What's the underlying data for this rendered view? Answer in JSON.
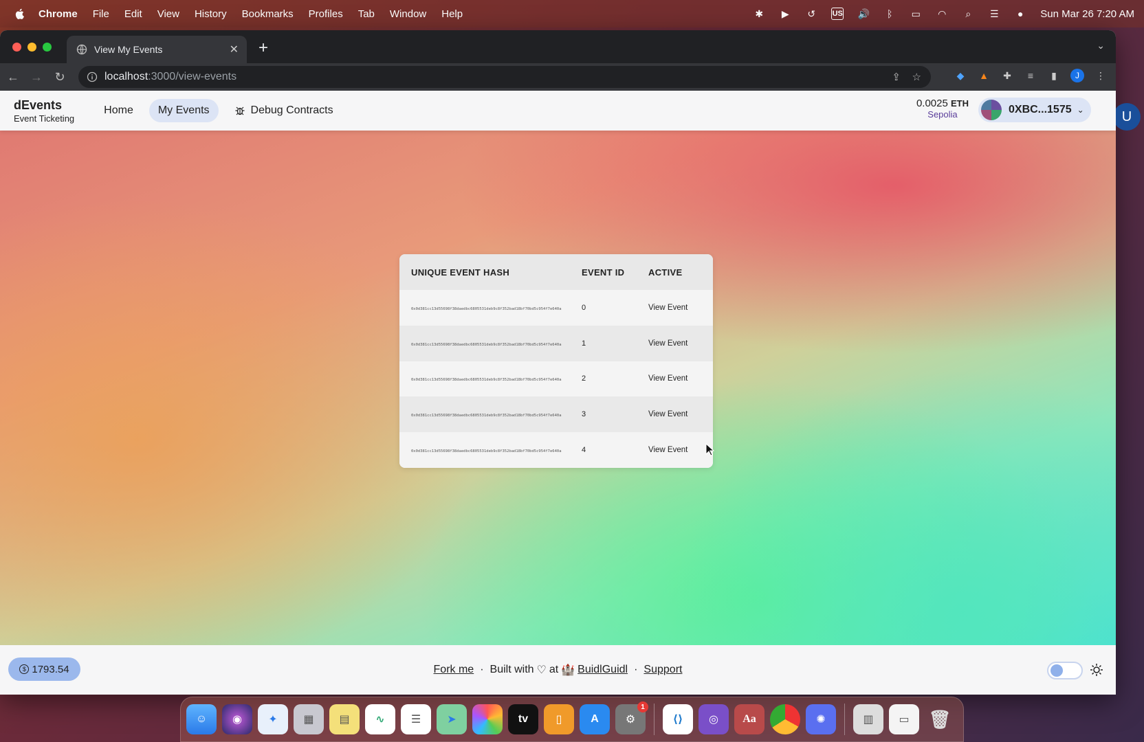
{
  "menubar": {
    "items": [
      "Chrome",
      "File",
      "Edit",
      "View",
      "History",
      "Bookmarks",
      "Profiles",
      "Tab",
      "Window",
      "Help"
    ],
    "input_source": "US",
    "datetime": "Sun Mar 26  7:20 AM"
  },
  "browser": {
    "tab_title": "View My Events",
    "url_host": "localhost",
    "url_path": ":3000/view-events",
    "profile_initial": "J"
  },
  "app": {
    "brand_name": "dEvents",
    "brand_subtitle": "Event Ticketing",
    "nav": {
      "home": "Home",
      "my_events": "My Events",
      "debug": "Debug Contracts"
    },
    "balance": "0.0025",
    "balance_unit": "ETH",
    "network": "Sepolia",
    "wallet_address": "0XBC...1575"
  },
  "table": {
    "headers": [
      "UNIQUE EVENT HASH",
      "EVENT ID",
      "ACTIVE"
    ],
    "rows": [
      {
        "hash": "0x0d381cc13d55698f38daedbc6805531deb9c8f352bad18bf70bd5c954f7e640a",
        "id": "0",
        "action": "View Event"
      },
      {
        "hash": "0x0d381cc13d55698f38daedbc6805531deb9c8f352bad18bf70bd5c954f7e640a",
        "id": "1",
        "action": "View Event"
      },
      {
        "hash": "0x0d381cc13d55698f38daedbc6805531deb9c8f352bad18bf70bd5c954f7e640a",
        "id": "2",
        "action": "View Event"
      },
      {
        "hash": "0x0d381cc13d55698f38daedbc6805531deb9c8f352bad18bf70bd5c954f7e640a",
        "id": "3",
        "action": "View Event"
      },
      {
        "hash": "0x0d381cc13d55698f38daedbc6805531deb9c8f352bad18bf70bd5c954f7e640a",
        "id": "4",
        "action": "View Event"
      }
    ]
  },
  "footer": {
    "price": "1793.54",
    "fork": "Fork me",
    "built_with": "Built with",
    "at": "at",
    "buidlguidl": "BuidlGuidl",
    "support": "Support"
  },
  "side_peek_initial": "U",
  "dock": {
    "badge": "1",
    "dictionary_label": "Aa"
  },
  "colors": {
    "accent": "#dce4f5",
    "network": "#5a3d9a",
    "price_pill": "#9bb8ec"
  }
}
